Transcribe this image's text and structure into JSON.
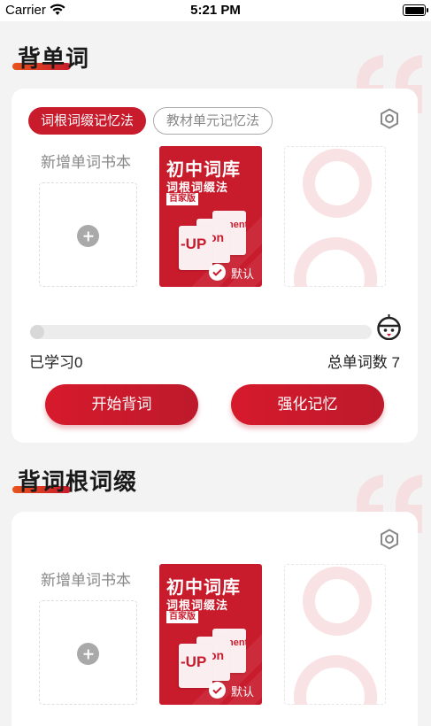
{
  "status_bar": {
    "carrier": "Carrier",
    "time": "5:21 PM"
  },
  "colors": {
    "accent": "#c81b2c",
    "gradient_start": "#e8541e"
  },
  "sections": [
    {
      "title": "背单词",
      "tabs": [
        {
          "label": "词根词缀记忆法",
          "active": true
        },
        {
          "label": "教材单元记忆法",
          "active": false
        }
      ],
      "add_label": "新增单词书本",
      "book": {
        "title": "初中词库",
        "subtitle": "词根词缀法",
        "tag": "百家版",
        "block_text_1": "-UP",
        "block_text_2": "on",
        "block_text_3": "nent",
        "default_label": "默认"
      },
      "progress_fraction": 0.0,
      "learned_label": "已学习0",
      "total_label": "总单词数 7",
      "buttons": {
        "start": "开始背词",
        "reinforce": "强化记忆"
      }
    },
    {
      "title": "背词根词缀",
      "add_label": "新增单词书本",
      "book": {
        "title": "初中词库",
        "subtitle": "词根词缀法",
        "tag": "百家版",
        "block_text_1": "-UP",
        "block_text_2": "on",
        "block_text_3": "nent",
        "default_label": "默认"
      }
    }
  ],
  "icons": [
    "wifi-icon",
    "battery-icon",
    "settings-icon",
    "plus-icon",
    "check-icon",
    "mascot-icon",
    "quote-deco-icon"
  ]
}
